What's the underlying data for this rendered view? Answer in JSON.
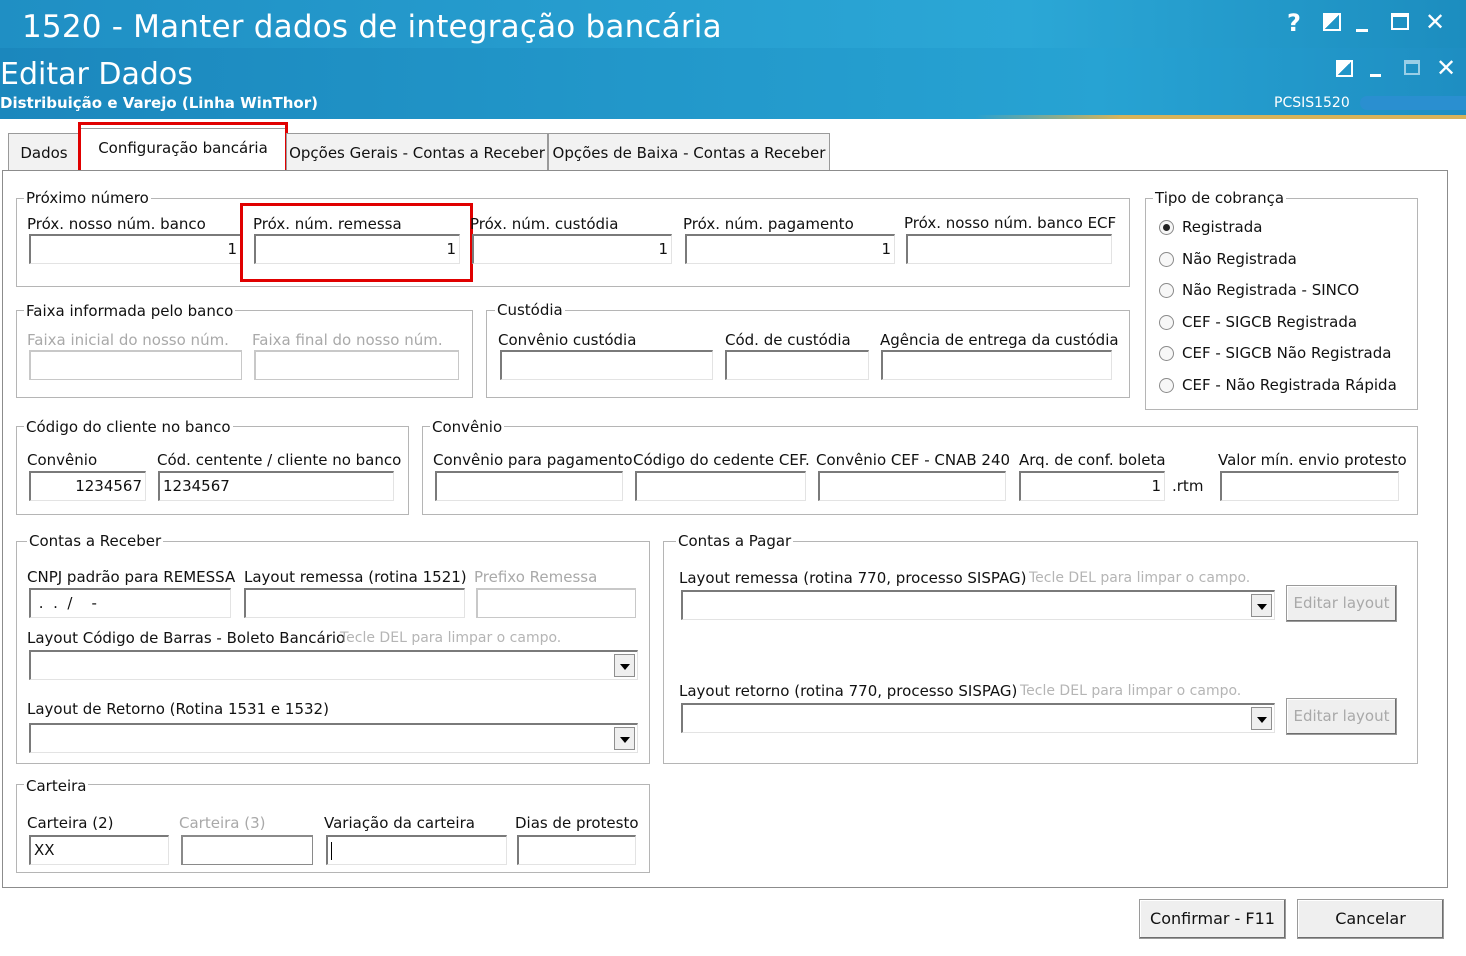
{
  "window": {
    "title": "1520 - Manter dados de integração bancária"
  },
  "header": {
    "title": "Editar Dados",
    "subtitle": "Distribuição e Varejo (Linha WinThor)",
    "code": "PCSIS1520"
  },
  "tabs": [
    {
      "label": "Dados"
    },
    {
      "label": "Configuração bancária"
    },
    {
      "label": "Opções Gerais - Contas a Receber"
    },
    {
      "label": "Opções de Baixa - Contas a Receber"
    }
  ],
  "proximo_numero": {
    "title": "Próximo número",
    "fields": [
      {
        "label": "Próx. nosso núm. banco",
        "value": "1"
      },
      {
        "label": "Próx. núm. remessa",
        "value": "1"
      },
      {
        "label": "Próx. núm. custódia",
        "value": "1"
      },
      {
        "label": "Próx. núm. pagamento",
        "value": "1"
      },
      {
        "label": "Próx. nosso núm. banco ECF",
        "value": ""
      }
    ]
  },
  "tipo_cobranca": {
    "title": "Tipo de cobrança",
    "options": [
      "Registrada",
      "Não Registrada",
      "Não Registrada - SINCO",
      "CEF - SIGCB Registrada",
      "CEF - SIGCB Não Registrada",
      "CEF - Não Registrada Rápida"
    ],
    "selected": "Registrada"
  },
  "faixa": {
    "title": "Faixa informada pelo banco",
    "inicial_label": "Faixa inicial do nosso núm.",
    "final_label": "Faixa final do nosso núm."
  },
  "custodia": {
    "title": "Custódia",
    "convenio_label": "Convênio custódia",
    "cod_label": "Cód. de custódia",
    "agencia_label": "Agência de entrega da custódia"
  },
  "codigo_cliente": {
    "title": "Código do cliente no banco",
    "convenio_label": "Convênio",
    "convenio_value": "1234567",
    "cedente_label": "Cód. centente / cliente no banco",
    "cedente_value": "1234567"
  },
  "convenio": {
    "title": "Convênio",
    "pagamento_label": "Convênio para pagamento",
    "cedente_cef_label": "Código do cedente CEF.",
    "cnab_label": "Convênio CEF - CNAB 240",
    "arq_label": "Arq. de conf. boleta",
    "arq_value": "1",
    "arq_suffix": ".rtm",
    "valor_label": "Valor mín. envio protesto"
  },
  "contas_receber": {
    "title": "Contas a Receber",
    "cnpj_label": "CNPJ padrão para REMESSA",
    "cnpj_value": " .  .  /    -",
    "layout_remessa_label": "Layout remessa (rotina 1521)",
    "prefixo_label": "Prefixo Remessa",
    "barras_label": "Layout Código de Barras - Boleto Bancário",
    "hint": "Tecle DEL para limpar o campo.",
    "retorno_label": "Layout  de Retorno (Rotina 1531 e 1532)"
  },
  "contas_pagar": {
    "title": "Contas a Pagar",
    "remessa_label": "Layout remessa (rotina 770, processo SISPAG)",
    "retorno_label": "Layout retorno (rotina 770, processo SISPAG)",
    "hint": "Tecle DEL para limpar o campo.",
    "edit_label": "Editar layout"
  },
  "carteira": {
    "title": "Carteira",
    "c2_label": "Carteira (2)",
    "c2_value": "XX",
    "c3_label": "Carteira (3)",
    "variacao_label": "Variação da carteira",
    "dias_label": "Dias de protesto"
  },
  "buttons": {
    "confirm": "Confirmar - F11",
    "cancel": "Cancelar"
  }
}
